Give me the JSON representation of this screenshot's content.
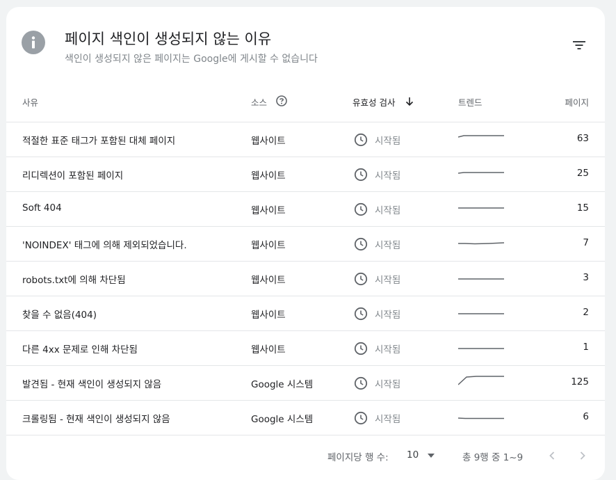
{
  "header": {
    "title": "페이지 색인이 생성되지 않는 이유",
    "subtitle": "색인이 생성되지 않은 페이지는 Google에 게시할 수 없습니다"
  },
  "table": {
    "columns": {
      "reason": "사유",
      "source": "소스",
      "validation": "유효성 검사",
      "trend": "트렌드",
      "pages": "페이지"
    },
    "sort": "validation-descending",
    "rows": [
      {
        "reason": "적절한 표준 태그가 포함된 대체 페이지",
        "source": "웹사이트",
        "status": "시작됨",
        "pages": "63"
      },
      {
        "reason": "리디렉션이 포함된 페이지",
        "source": "웹사이트",
        "status": "시작됨",
        "pages": "25"
      },
      {
        "reason": "Soft 404",
        "source": "웹사이트",
        "status": "시작됨",
        "pages": "15"
      },
      {
        "reason": "'NOINDEX' 태그에 의해 제외되었습니다.",
        "source": "웹사이트",
        "status": "시작됨",
        "pages": "7"
      },
      {
        "reason": "robots.txt에 의해 차단됨",
        "source": "웹사이트",
        "status": "시작됨",
        "pages": "3"
      },
      {
        "reason": "찾을 수 없음(404)",
        "source": "웹사이트",
        "status": "시작됨",
        "pages": "2"
      },
      {
        "reason": "다른 4xx 문제로 인해 차단됨",
        "source": "웹사이트",
        "status": "시작됨",
        "pages": "1"
      },
      {
        "reason": "발견됨 - 현재 색인이 생성되지 않음",
        "source": "Google 시스템",
        "status": "시작됨",
        "pages": "125"
      },
      {
        "reason": "크롤링됨 - 현재 색인이 생성되지 않음",
        "source": "Google 시스템",
        "status": "시작됨",
        "pages": "6"
      }
    ]
  },
  "footer": {
    "rows_per_page_label": "페이지당 행 수:",
    "rows_per_page_value": "10",
    "range_text": "총 9행 중 1~9"
  },
  "icons": {
    "header": "info-icon",
    "filter": "filter-icon",
    "source_help": "help-icon",
    "sort": "arrow-down-icon",
    "status": "clock-icon",
    "dropdown": "caret-down-icon",
    "prev": "chevron-left-icon",
    "next": "chevron-right-icon"
  },
  "colors": {
    "icon_gray": "#9aa0a6",
    "text_primary": "#202124",
    "text_secondary": "#80868b",
    "sparkline": "#5f6368"
  }
}
